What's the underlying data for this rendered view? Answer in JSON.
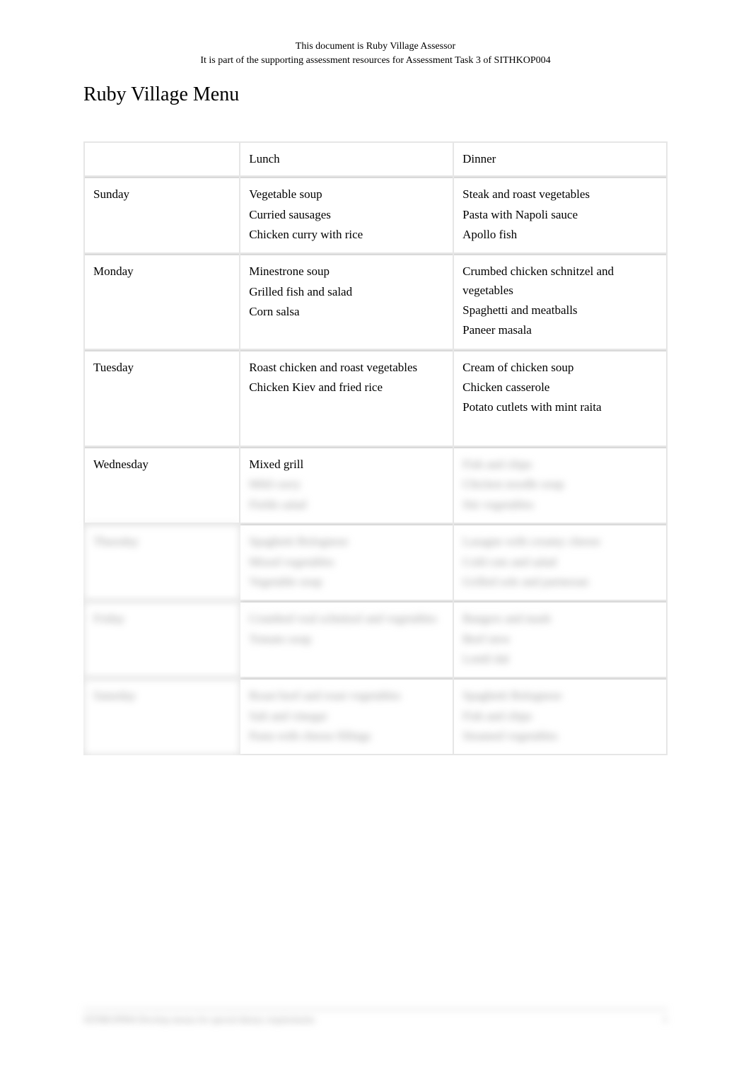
{
  "header": {
    "line1": "This document is Ruby Village Assessor",
    "line2": "It is part of the supporting assessment resources for Assessment Task 3 of SITHKOP004"
  },
  "title": "Ruby Village Menu",
  "columns": {
    "empty": "",
    "lunch": "Lunch",
    "dinner": "Dinner"
  },
  "rows": [
    {
      "day": "Sunday",
      "lunch": [
        "Vegetable soup",
        "Curried sausages",
        "Chicken curry with rice"
      ],
      "dinner": [
        "Steak and roast vegetables",
        "Pasta with Napoli sauce",
        "Apollo fish"
      ],
      "blurred": false
    },
    {
      "day": "Monday",
      "lunch": [
        "Minestrone soup",
        "Grilled fish and salad",
        "Corn salsa"
      ],
      "dinner": [
        "Crumbed chicken schnitzel and vegetables",
        "Spaghetti and meatballs",
        "Paneer masala"
      ],
      "blurred": false
    },
    {
      "day": "Tuesday",
      "lunch": [
        "Roast chicken and roast vegetables",
        "Chicken Kiev and fried rice",
        " "
      ],
      "dinner": [
        "Cream of chicken soup",
        "Chicken casserole",
        "Potato cutlets with mint raita",
        " "
      ],
      "blurred": false
    },
    {
      "day": "Wednesday",
      "lunch": [
        "Mixed grill"
      ],
      "dinner": [],
      "blurred": false,
      "partial_blur": {
        "lunch_extra": [
          "Mild curry",
          "Fields salad"
        ],
        "dinner_extra": [
          "Fish and chips",
          "Chicken noodle soup",
          "Stir vegetables"
        ]
      }
    },
    {
      "day": "Thursday",
      "lunch": [
        "Spaghetti Bolognese",
        "Mixed vegetables",
        "Vegetable soup"
      ],
      "dinner": [
        "Lasagne with creamy cheese",
        "Cold cuts and salad",
        "Grilled sole and parmesan"
      ],
      "blurred": true
    },
    {
      "day": "Friday",
      "lunch": [
        "Crumbed veal schnitzel and vegetables",
        "Tomato soup"
      ],
      "dinner": [
        "Bangers and mash",
        "Beef stew",
        "Lentil dal"
      ],
      "blurred": true
    },
    {
      "day": "Saturday",
      "lunch": [
        "Roast beef and roast vegetables",
        "Salt and vinegar",
        "Pasta with cheese fillings"
      ],
      "dinner": [
        "Spaghetti Bolognese",
        "Fish and chips",
        "Steamed vegetables"
      ],
      "blurred": true
    }
  ],
  "footer": {
    "left": "SITHKOP004 Develop menus for special dietary requirements",
    "right": "1"
  }
}
